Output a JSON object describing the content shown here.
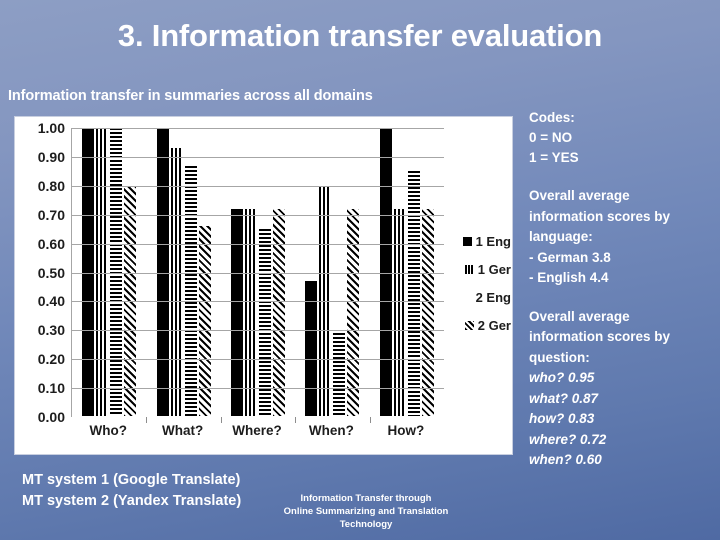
{
  "slide": {
    "title": "3. Information transfer evaluation",
    "chart_caption": "Information transfer in summaries across all domains",
    "footer": [
      "Information Transfer through",
      "Online Summarizing and Translation",
      "Technology"
    ],
    "mt_notes": [
      "MT system 1 (Google Translate)",
      "MT system 2 (Yandex Translate)"
    ]
  },
  "right_column": {
    "codes": {
      "heading": "Codes:",
      "lines": [
        "0 = NO",
        "1 = YES"
      ]
    },
    "by_language": {
      "heading_lines": [
        "Overall average",
        "information scores by",
        "language:"
      ],
      "items": [
        "- German 3.8",
        "- English 4.4"
      ]
    },
    "by_question": {
      "heading_lines": [
        "Overall average",
        "information scores by",
        "question:"
      ],
      "items": [
        "who? 0.95",
        "what? 0.87",
        "how? 0.83",
        "where? 0.72",
        "when? 0.60"
      ]
    }
  },
  "chart_data": {
    "type": "bar",
    "title": "Information transfer in summaries across all domains",
    "xlabel": "",
    "ylabel": "",
    "ylim": [
      0,
      1.0
    ],
    "grid": true,
    "legend_position": "right",
    "categories": [
      "Who?",
      "What?",
      "Where?",
      "When?",
      "How?"
    ],
    "ytick_labels": [
      "1.00",
      "0.90",
      "0.80",
      "0.70",
      "0.60",
      "0.50",
      "0.40",
      "0.30",
      "0.20",
      "0.10",
      "0.00"
    ],
    "ytick_values": [
      1.0,
      0.9,
      0.8,
      0.7,
      0.6,
      0.5,
      0.4,
      0.3,
      0.2,
      0.1,
      0.0
    ],
    "series": [
      {
        "name": "1 Eng",
        "pattern": "solid",
        "values": [
          1.0,
          1.0,
          0.72,
          0.47,
          1.0
        ]
      },
      {
        "name": "1 Ger",
        "pattern": "vertical",
        "values": [
          1.0,
          0.93,
          0.72,
          0.8,
          0.72
        ]
      },
      {
        "name": "2 Eng",
        "pattern": "horizontal",
        "values": [
          1.0,
          0.87,
          0.65,
          0.29,
          0.85
        ]
      },
      {
        "name": "2 Ger",
        "pattern": "diagonal",
        "values": [
          0.8,
          0.66,
          0.72,
          0.72,
          0.72
        ]
      }
    ]
  }
}
